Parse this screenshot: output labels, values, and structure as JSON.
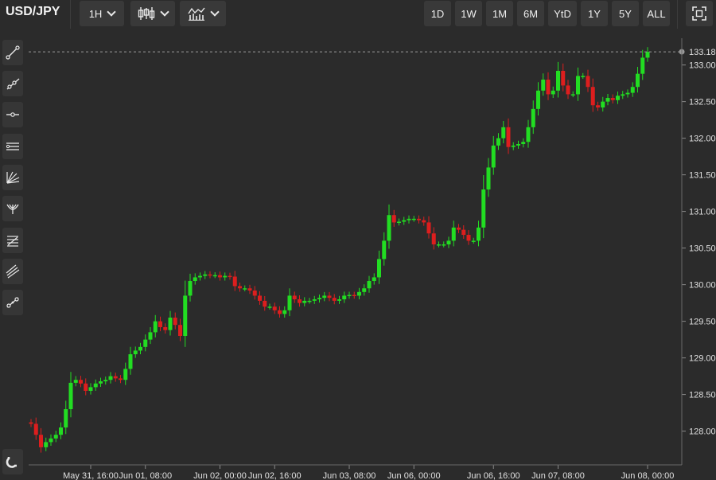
{
  "toolbar": {
    "symbol": "USD/JPY",
    "interval_label": "1H",
    "chart_type_icon": "candlestick-icon",
    "indicators_icon": "indicators-icon",
    "ranges": [
      "1D",
      "1W",
      "1M",
      "6M",
      "YtD",
      "1Y",
      "5Y",
      "ALL"
    ],
    "fullscreen_icon": "fullscreen-icon"
  },
  "left_tools": [
    "trend-line-icon",
    "ray-icon",
    "horizontal-line-icon",
    "parallel-channel-icon",
    "fan-icon",
    "pitchfork-icon",
    "fibonacci-icon",
    "regression-channel-icon",
    "measure-icon",
    "magnet-icon"
  ],
  "colors": {
    "up": "#22dd22",
    "down": "#dd1e1e",
    "background": "#2b2b2b",
    "last_price_line": "#9a9a9a"
  },
  "chart_data": {
    "type": "candlestick",
    "symbol": "USD/JPY",
    "interval": "1H",
    "ylim": [
      127.55,
      133.42
    ],
    "y_ticks": [
      "128.00",
      "128.50",
      "129.00",
      "129.50",
      "130.00",
      "130.50",
      "131.00",
      "131.50",
      "132.00",
      "132.50",
      "133.00"
    ],
    "last_price": "133.18",
    "x_tick_labels": [
      "May 31, 16:00",
      "Jun 01, 08:00",
      "Jun 02, 00:00",
      "Jun 02, 16:00",
      "Jun 03, 08:00",
      "Jun 06, 00:00",
      "Jun 06, 16:00",
      "Jun 07, 08:00",
      "Jun 08, 00:00"
    ],
    "grid": false,
    "close": [
      128.1,
      127.95,
      127.78,
      127.85,
      127.9,
      127.95,
      128.05,
      128.3,
      128.66,
      128.7,
      128.65,
      128.55,
      128.6,
      128.65,
      128.68,
      128.7,
      128.75,
      128.72,
      128.7,
      128.85,
      129.05,
      129.1,
      129.15,
      129.25,
      129.35,
      129.5,
      129.42,
      129.38,
      129.55,
      129.45,
      129.3,
      129.85,
      130.05,
      130.1,
      130.12,
      130.14,
      130.13,
      130.13,
      130.1,
      130.12,
      130.11,
      129.98,
      129.95,
      129.95,
      129.92,
      129.85,
      129.78,
      129.7,
      129.7,
      129.65,
      129.6,
      129.65,
      129.85,
      129.8,
      129.75,
      129.78,
      129.78,
      129.8,
      129.82,
      129.85,
      129.82,
      129.78,
      129.8,
      129.85,
      129.86,
      129.85,
      129.9,
      129.95,
      130.05,
      130.1,
      130.35,
      130.6,
      130.95,
      130.85,
      130.86,
      130.88,
      130.9,
      130.9,
      130.88,
      130.85,
      130.7,
      130.55,
      130.55,
      130.55,
      130.6,
      130.78,
      130.75,
      130.68,
      130.6,
      130.6,
      130.78,
      131.3,
      131.6,
      131.9,
      132.0,
      132.15,
      131.88,
      131.9,
      131.92,
      131.95,
      132.15,
      132.4,
      132.65,
      132.8,
      132.6,
      132.65,
      132.92,
      132.72,
      132.6,
      132.6,
      132.85,
      132.85,
      132.7,
      132.45,
      132.42,
      132.5,
      132.55,
      132.52,
      132.58,
      132.6,
      132.62,
      132.7,
      132.88,
      133.1,
      133.18
    ]
  }
}
